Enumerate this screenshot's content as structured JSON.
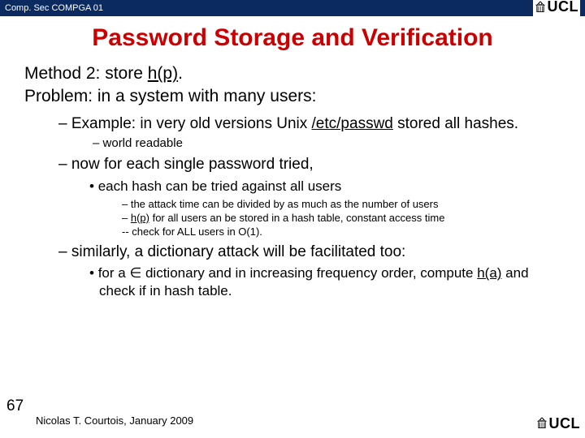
{
  "header": {
    "course": "Comp. Sec COMPGA 01",
    "logo_text": "UCL"
  },
  "title": "Password Storage and Verification",
  "method": {
    "line1_a": "Method 2: store ",
    "line1_b": "h(p)",
    "line1_c": ".",
    "line2": "Problem: in a system with many users:"
  },
  "b1": {
    "ex_a": "Example: in very old versions Unix ",
    "ex_b": "/etc/passwd",
    "ex_c": " stored all hashes.",
    "sub1": "world readable",
    "now": "now for each single password tried,",
    "bul1": "each hash can be tried against all users",
    "s1": "the attack time can be divided by as much as the number of users",
    "s2_a": "h(p)",
    "s2_b": " for all users an be stored in a hash table, constant access time",
    "s3": "check for ALL users in O(1).",
    "sim": "similarly, a dictionary attack will be facilitated too:",
    "dict_a": "for a ",
    "dict_b": "∈",
    "dict_c": " dictionary and in increasing frequency order, compute ",
    "dict_d": "h(a)",
    "dict_e": " and check if in hash table."
  },
  "footer": {
    "num": "67",
    "author": "Nicolas T. Courtois, January 2009",
    "logo_text": "UCL"
  }
}
